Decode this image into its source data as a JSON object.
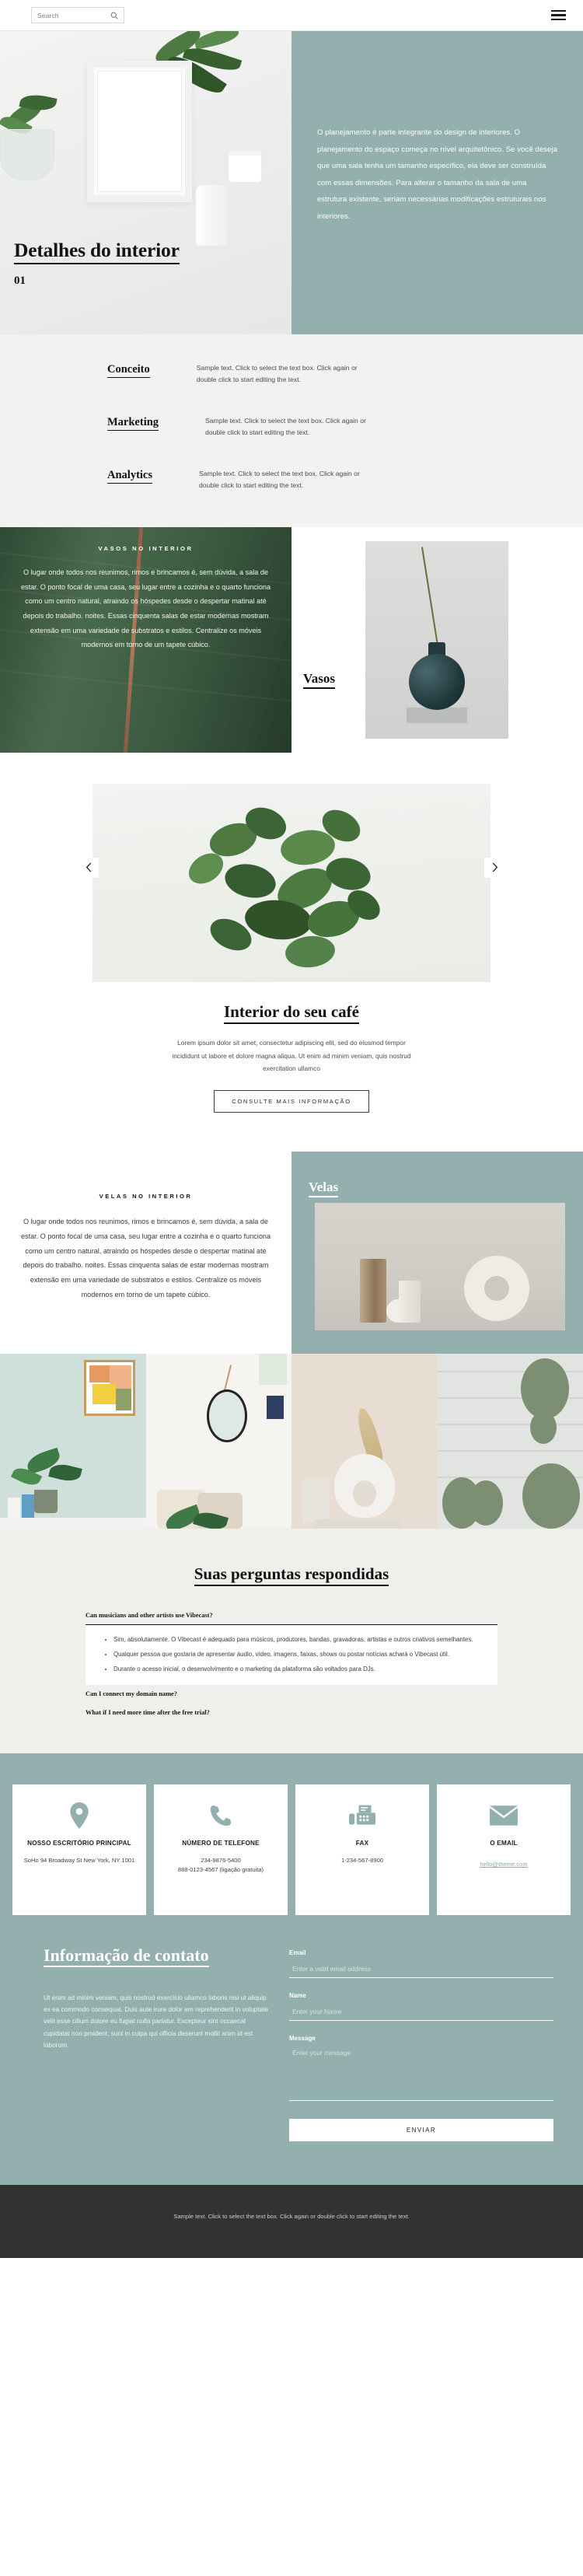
{
  "topbar": {
    "search_placeholder": "Search",
    "search_value": "",
    "search_icon": "search-icon",
    "menu_icon": "hamburger-menu-icon"
  },
  "hero": {
    "title": "Detalhes do interior",
    "number": "01",
    "paragraph": "O planejamento é parte integrante do design de interiores. O planejamento do espaço começa no nível arquitetônico. Se você deseja que uma sala tenha um tamanho específico, ela deve ser construída com essas dimensões. Para alterar o tamanho da sala de uma estrutura existente, seriam necessárias modificações estruturais nos interiores."
  },
  "features": [
    {
      "title": "Conceito",
      "text": "Sample text. Click to select the text box. Click again or double click to start editing the text."
    },
    {
      "title": "Marketing",
      "text": "Sample text. Click to select the text box. Click again or double click to start editing the text."
    },
    {
      "title": "Analytics",
      "text": "Sample text. Click to select the text box. Click again or double click to start editing the text."
    }
  ],
  "vasos": {
    "kicker": "VASOS NO INTERIOR",
    "paragraph": "O lugar onde todos nos reunimos, rimos e brincamos é, sem dúvida, a sala de estar. O ponto focal de uma casa, seu lugar entre a cozinha e o quarto funciona como um centro natural, atraindo os hóspedes desde o despertar matinal até depois do trabalho. noites. Essas cinquenta salas de estar modernas mostram extensão em uma variedade de substratos e estilos. Centralize os móveis modernos em torno de um tapete cúbico.",
    "label": "Vasos"
  },
  "carousel": {
    "prev_icon": "chevron-left-icon",
    "next_icon": "chevron-right-icon"
  },
  "cta": {
    "title": "Interior do seu café",
    "text": "Lorem ipsum dolor sit amet, consectetur adipiscing elit, sed do eiusmod tempor incididunt ut labore et dolore magna aliqua. Ut enim ad minim veniam, quis nostrud exercitation ullamco",
    "button": "CONSULTE MAIS INFORMAÇÃO"
  },
  "velas": {
    "kicker": "VELAS NO INTERIOR",
    "paragraph": "O lugar onde todos nos reunimos, rimos e brincamos é, sem dúvida, a sala de estar. O ponto focal de uma casa, seu lugar entre a cozinha e o quarto funciona como um centro natural, atraindo os hóspedes desde o despertar matinal até depois do trabalho. noites. Essas cinquenta salas de estar modernas mostram extensão em uma variedade de substratos e estilos. Centralize os móveis modernos em torno de um tapete cúbico.",
    "label": "Velas"
  },
  "gallery": [
    {
      "name": "plant-and-wall-art-photo"
    },
    {
      "name": "mirror-and-pillows-photo"
    },
    {
      "name": "white-donut-vase-photo"
    },
    {
      "name": "cactus-photo"
    }
  ],
  "faq": {
    "title": "Suas perguntas respondidas",
    "items": [
      {
        "question": "Can musicians and other artists use Vibecast?",
        "open": true,
        "answers": [
          "Sim, absolutamente. O Vibecast é adequado para músicos, produtores, bandas, gravadoras, artistas e outros criativos semelhantes.",
          "Qualquer pessoa que gostaria de apresentar áudio, vídeo, imagens, faixas, shows ou postar notícias achará o Vibecast útil.",
          "Durante o acesso inicial, o desenvolvimento e o marketing da plataforma são voltados para DJs."
        ]
      },
      {
        "question": "Can I connect my domain name?",
        "open": false,
        "answers": []
      },
      {
        "question": "What if I need more time after the free trial?",
        "open": false,
        "answers": []
      }
    ]
  },
  "contact_cards": [
    {
      "icon": "location-pin-icon",
      "title": "NOSSO ESCRITÓRIO PRINCIPAL",
      "lines": [
        "SoHo 94 Broadway St New York, NY 1001"
      ],
      "link": ""
    },
    {
      "icon": "phone-icon",
      "title": "NÚMERO DE TELEFONE",
      "lines": [
        "234-9876-5400",
        "888-0123-4567 (ligação gratuita)"
      ],
      "link": ""
    },
    {
      "icon": "fax-icon",
      "title": "FAX",
      "lines": [
        "1-234-567-8900"
      ],
      "link": ""
    },
    {
      "icon": "envelope-icon",
      "title": "O EMAIL",
      "lines": [],
      "link": "hello@theme.com"
    }
  ],
  "contact_form": {
    "title": "Informação de contato",
    "description": "Ut enim ad minim veniam, quis nostrud exercício ullamco laboris nisi ut aliquip ex ea commodo consequat. Duis aute irure dolor em reprehenderit in voluptate velit esse cillum dolore eu fugiat nulla pariatur. Excepteur sint occaecat cupidatat non proident, sunt in culpa qui officia deserunt mollit anim id est laborum.",
    "fields": [
      {
        "label": "Email",
        "placeholder": "Enter a valid email address",
        "value": "",
        "type": "input"
      },
      {
        "label": "Name",
        "placeholder": "Enter your Name",
        "value": "",
        "type": "input"
      },
      {
        "label": "Message",
        "placeholder": "Enter your message",
        "value": "",
        "type": "textarea"
      }
    ],
    "submit": "ENVIAR"
  },
  "footer": {
    "text": "Sample text. Click to select the text box. Click again or double click to start editing the text."
  },
  "colors": {
    "accent_teal": "#93b0ae",
    "dark_footer": "#323232",
    "light_grey": "#f2f2f0"
  }
}
